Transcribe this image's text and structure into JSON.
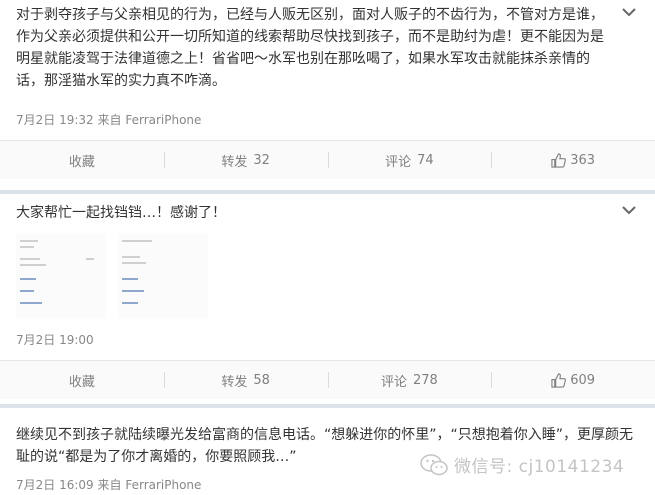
{
  "posts": [
    {
      "text": "对于剥夺孩子与父亲相见的行为，已经与人贩无区别，面对人贩子的不齿行为，不管对方是谁，作为父亲必须提供和公开一切所知道的线索帮助尽快找到孩子，而不是助纣为虐！更不能因为是明星就能凌驾于法律道德之上！省省吧～水军也别在那吆喝了，如果水军攻击就能抹杀亲情的话，那淫猫水军的实力真不咋滴。",
      "date": "7月2日",
      "time": "19:32",
      "source": "来自 FerrariPhone",
      "actions": {
        "collect": "收藏",
        "repost_label": "转发",
        "repost_count": "32",
        "comment_label": "评论",
        "comment_count": "74",
        "like_count": "363"
      }
    },
    {
      "text": "大家帮忙一起找铛铛…！感谢了！",
      "date": "7月2日",
      "time": "19:00",
      "actions": {
        "collect": "收藏",
        "repost_label": "转发",
        "repost_count": "58",
        "comment_label": "评论",
        "comment_count": "278",
        "like_count": "609"
      }
    },
    {
      "text": "继续见不到孩子就陆续曝光发给富商的信息电话。“想躲进你的怀里”，“只想抱着你入睡”，更厚颜无耻的说“都是为了你才离婚的，你要照顾我…”",
      "date": "7月2日",
      "time": "16:09",
      "source": "来自 FerrariPhone"
    }
  ],
  "watermark": {
    "text": "微信号: cj10141234"
  },
  "icons": {
    "dropdown": "chevron-down-icon",
    "like": "thumbs-up-icon",
    "watermark": "wechat-icon"
  },
  "colors": {
    "background": "#dde3ea",
    "card": "#ffffff",
    "meta": "#888888"
  }
}
